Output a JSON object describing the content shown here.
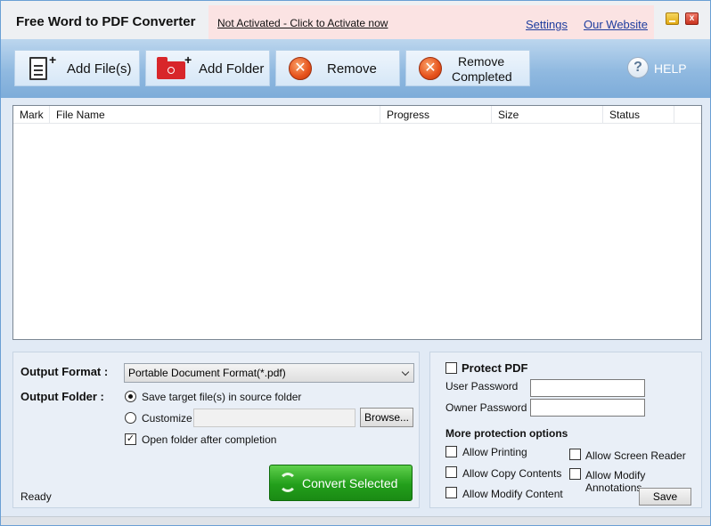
{
  "app": {
    "title": "Free Word to PDF Converter"
  },
  "notice": {
    "activate_link": "Not Activated - Click to Activate now",
    "settings": "Settings",
    "website": "Our Website"
  },
  "window": {
    "close_glyph": "x"
  },
  "toolbar": {
    "add_files": "Add File(s)",
    "add_folder": "Add Folder",
    "remove": "Remove",
    "remove_completed_line1": "Remove",
    "remove_completed_line2": "Completed",
    "help": "HELP"
  },
  "table": {
    "columns": [
      "Mark",
      "File Name",
      "Progress",
      "Size",
      "Status"
    ],
    "rows": []
  },
  "output": {
    "format_label": "Output Format :",
    "format_value": "Portable Document Format(*.pdf)",
    "folder_label": "Output Folder :",
    "source_folder_option": "Save target file(s) in source folder",
    "customize_option": "Customize :",
    "customize_path": "",
    "browse": "Browse...",
    "open_folder_option": "Open folder after completion",
    "open_folder_checked": true,
    "convert": "Convert Selected",
    "status": "Ready"
  },
  "protection": {
    "protect_pdf": "Protect PDF",
    "user_password_label": "User Password",
    "owner_password_label": "Owner Password",
    "more_options": "More protection options",
    "allow_printing": "Allow Printing",
    "allow_copy": "Allow Copy Contents",
    "allow_modify_content": "Allow Modify Content",
    "allow_screen_reader": "Allow Screen Reader",
    "allow_modify_annotations": "Allow Modify Annotations",
    "save": "Save"
  }
}
